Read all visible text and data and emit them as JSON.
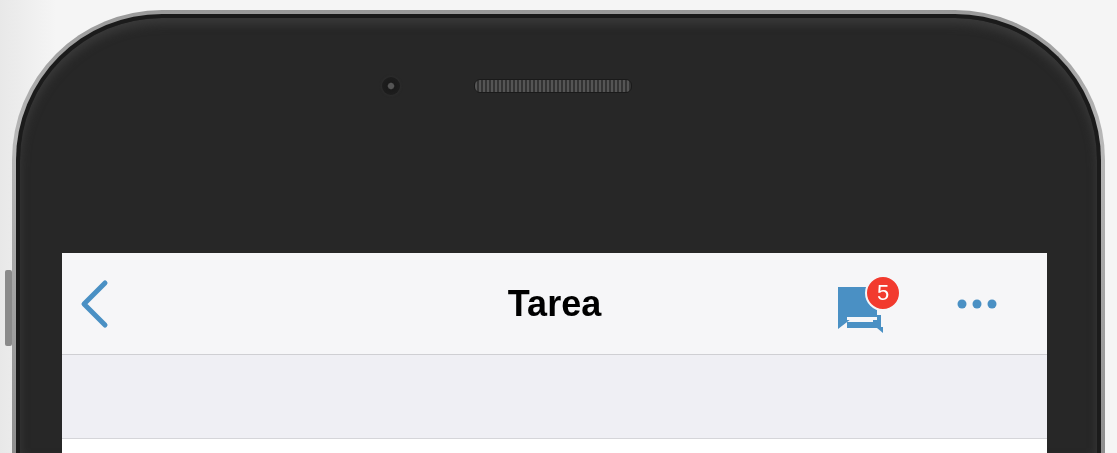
{
  "nav": {
    "title": "Tarea",
    "messages_badge": "5"
  }
}
